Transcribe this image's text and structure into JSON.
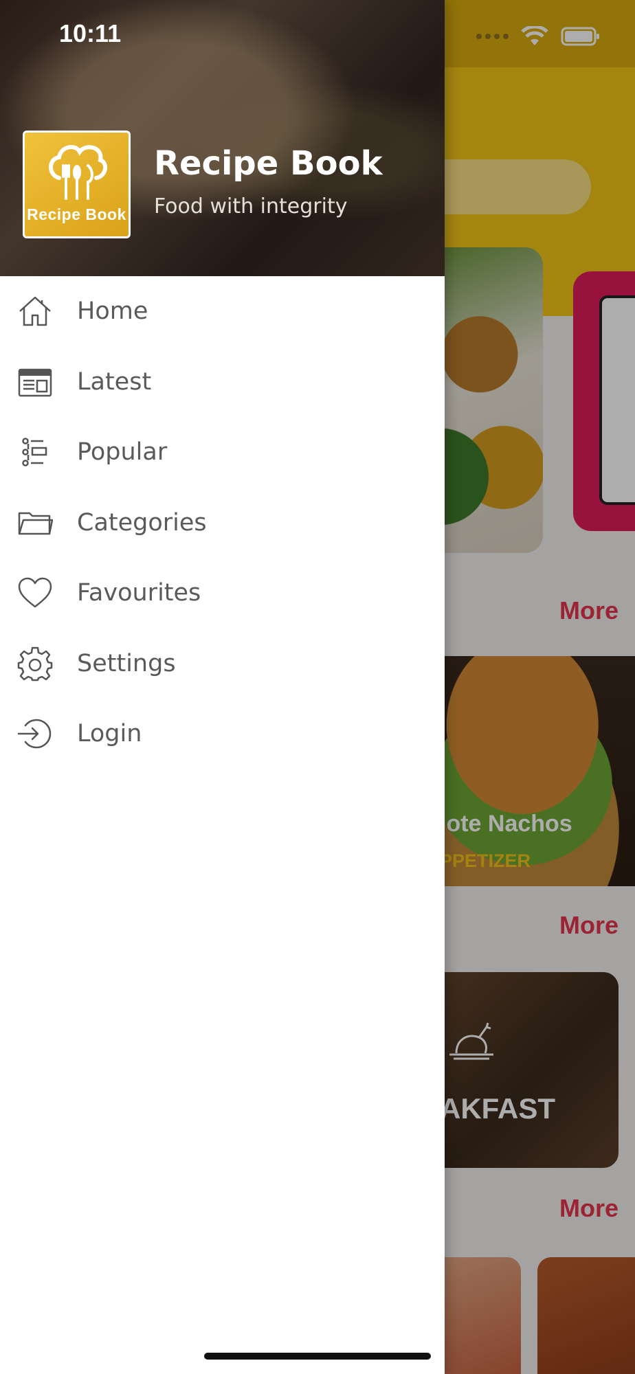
{
  "status_bar": {
    "time": "10:11"
  },
  "drawer": {
    "app_title": "Recipe Book",
    "app_subtitle": "Food with integrity",
    "logo_text": "Recipe Book",
    "menu": [
      {
        "label": "Home",
        "icon": "home-icon"
      },
      {
        "label": "Latest",
        "icon": "newspaper-icon"
      },
      {
        "label": "Popular",
        "icon": "list-icon"
      },
      {
        "label": "Categories",
        "icon": "folder-icon"
      },
      {
        "label": "Favourites",
        "icon": "heart-icon"
      },
      {
        "label": "Settings",
        "icon": "gear-icon"
      },
      {
        "label": "Login",
        "icon": "login-icon"
      }
    ]
  },
  "background": {
    "more_labels": [
      "More",
      "More",
      "More"
    ],
    "card_title": "lote  Nachos",
    "card_category": "PPETIZER",
    "category_card_label": "AKFAST"
  },
  "colors": {
    "accent": "#e5344d",
    "header_yellow": "#f1c519",
    "text_gray": "#5a5a5a"
  }
}
